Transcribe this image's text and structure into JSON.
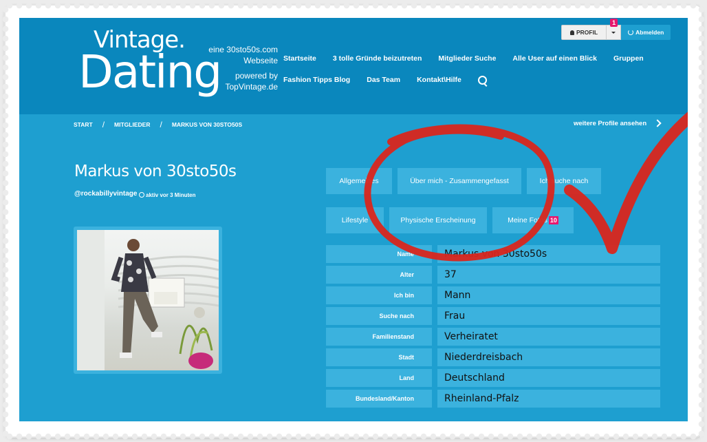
{
  "logo": {
    "line1": "Vintage.",
    "line2": "Dating",
    "side1": "eine 30sto50s.com",
    "side2": "Webseite",
    "side3": "powered by",
    "side4": "TopVintage.de"
  },
  "nav": {
    "row1": [
      "Startseite",
      "3 tolle Gründe beizutreten",
      "Mitglieder Suche",
      "Alle User auf einen Blick",
      "Gruppen"
    ],
    "row2": [
      "Fashion Tipps Blog",
      "Das Team",
      "Kontakt\\Hilfe"
    ]
  },
  "top": {
    "profil": "PROFIL",
    "notif_count": "1",
    "logout": "Abmelden"
  },
  "breadcrumb": {
    "items": [
      "START",
      "MITGLIEDER",
      "MARKUS VON 30STO50S"
    ],
    "sep": "/",
    "more": "weitere Profile ansehen"
  },
  "profile": {
    "name": "Markus von 30sto50s",
    "handle": "@rockabillyvintage",
    "active": "aktiv vor 3 Minuten"
  },
  "tabs": {
    "t1": "Allgemeines",
    "t2": "Über mich - Zusammengefasst",
    "t3": "Ich suche nach",
    "t4": "Lifestyle",
    "t5": "Physische Erscheinung",
    "t6": "Meine Fotos",
    "photos_count": "10"
  },
  "info": [
    {
      "label": "Name",
      "value": "Markus von 30sto50s"
    },
    {
      "label": "Alter",
      "value": "37"
    },
    {
      "label": "Ich bin",
      "value": "Mann"
    },
    {
      "label": "Suche nach",
      "value": "Frau"
    },
    {
      "label": "Familienstand",
      "value": "Verheiratet"
    },
    {
      "label": "Stadt",
      "value": "Niederdreisbach"
    },
    {
      "label": "Land",
      "value": "Deutschland"
    },
    {
      "label": "Bundesland/Kanton",
      "value": "Rheinland-Pfalz"
    }
  ],
  "colors": {
    "header": "#0a87bd",
    "page": "#1e9fd0",
    "cell": "#3bb2de",
    "badge": "#e8186e",
    "annotation": "#d9261c"
  }
}
